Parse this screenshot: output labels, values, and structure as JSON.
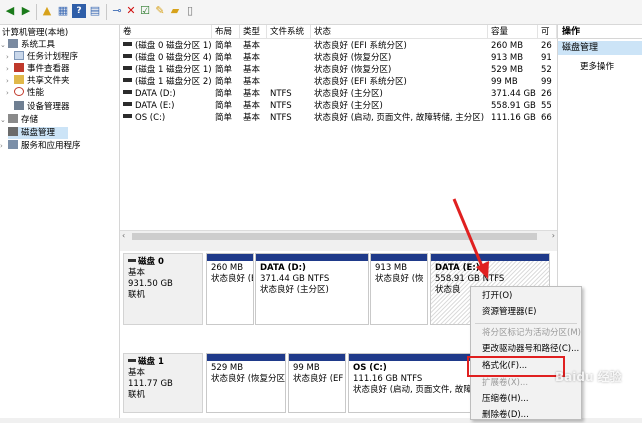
{
  "toolbar": {
    "icons": [
      "back-icon",
      "forward-icon",
      "folder-up-icon",
      "properties-icon",
      "help-icon",
      "view-icon",
      "connect-icon",
      "delete-icon",
      "check-icon",
      "new-icon",
      "open-folder-icon",
      "doc-icon"
    ]
  },
  "tree": {
    "root": "计算机管理(本地)",
    "system_tools": "系统工具",
    "task_scheduler": "任务计划程序",
    "event_viewer": "事件查看器",
    "shared_folders": "共享文件夹",
    "performance": "性能",
    "device_manager": "设备管理器",
    "storage": "存储",
    "disk_management": "磁盘管理",
    "services_apps": "服务和应用程序"
  },
  "volume_table": {
    "headers": [
      "卷",
      "布局",
      "类型",
      "文件系统",
      "状态",
      "容量",
      "可"
    ],
    "rows": [
      {
        "name": "(磁盘 0 磁盘分区 1)",
        "layout": "简单",
        "type": "基本",
        "fs": "",
        "status": "状态良好 (EFI 系统分区)",
        "capacity": "260 MB",
        "free": "26"
      },
      {
        "name": "(磁盘 0 磁盘分区 4)",
        "layout": "简单",
        "type": "基本",
        "fs": "",
        "status": "状态良好 (恢复分区)",
        "capacity": "913 MB",
        "free": "91"
      },
      {
        "name": "(磁盘 1 磁盘分区 1)",
        "layout": "简单",
        "type": "基本",
        "fs": "",
        "status": "状态良好 (恢复分区)",
        "capacity": "529 MB",
        "free": "52"
      },
      {
        "name": "(磁盘 1 磁盘分区 2)",
        "layout": "简单",
        "type": "基本",
        "fs": "",
        "status": "状态良好 (EFI 系统分区)",
        "capacity": "99 MB",
        "free": "99"
      },
      {
        "name": "DATA (D:)",
        "layout": "简单",
        "type": "基本",
        "fs": "NTFS",
        "status": "状态良好 (主分区)",
        "capacity": "371.44 GB",
        "free": "26"
      },
      {
        "name": "DATA (E:)",
        "layout": "简单",
        "type": "基本",
        "fs": "NTFS",
        "status": "状态良好 (主分区)",
        "capacity": "558.91 GB",
        "free": "55"
      },
      {
        "name": "OS (C:)",
        "layout": "简单",
        "type": "基本",
        "fs": "NTFS",
        "status": "状态良好 (启动, 页面文件, 故障转储, 主分区)",
        "capacity": "111.16 GB",
        "free": "66"
      }
    ]
  },
  "disks": {
    "disk0": {
      "name": "磁盘 0",
      "type": "基本",
      "size": "931.50 GB",
      "status": "联机",
      "parts": [
        {
          "title": "",
          "size": "260 MB",
          "status": "状态良好 (EFI"
        },
        {
          "title": "DATA (D:)",
          "size": "371.44 GB NTFS",
          "status": "状态良好 (主分区)"
        },
        {
          "title": "",
          "size": "913 MB",
          "status": "状态良好 (恢"
        },
        {
          "title": "DATA (E:)",
          "size": "558.91 GB NTFS",
          "status": "状态良"
        }
      ]
    },
    "disk1": {
      "name": "磁盘 1",
      "type": "基本",
      "size": "111.77 GB",
      "status": "联机",
      "parts": [
        {
          "title": "",
          "size": "529 MB",
          "status": "状态良好 (恢复分区"
        },
        {
          "title": "",
          "size": "99 MB",
          "status": "状态良好 (EF"
        },
        {
          "title": "OS (C:)",
          "size": "111.16 GB NTFS",
          "status": "状态良好 (启动, 页面文件, 故障转储, 主"
        }
      ]
    }
  },
  "actions": {
    "title": "操作",
    "selected": "磁盘管理",
    "more": "更多操作"
  },
  "context_menu": {
    "items": [
      "打开(O)",
      "资源管理器(E)",
      "将分区标记为活动分区(M)",
      "更改驱动器号和路径(C)...",
      "格式化(F)...",
      "扩展卷(X)...",
      "压缩卷(H)...",
      "删除卷(D)..."
    ]
  },
  "watermark": "Baidu 经验",
  "accent_color": "#e02020",
  "partition_bar_color": "#1f3a8a"
}
